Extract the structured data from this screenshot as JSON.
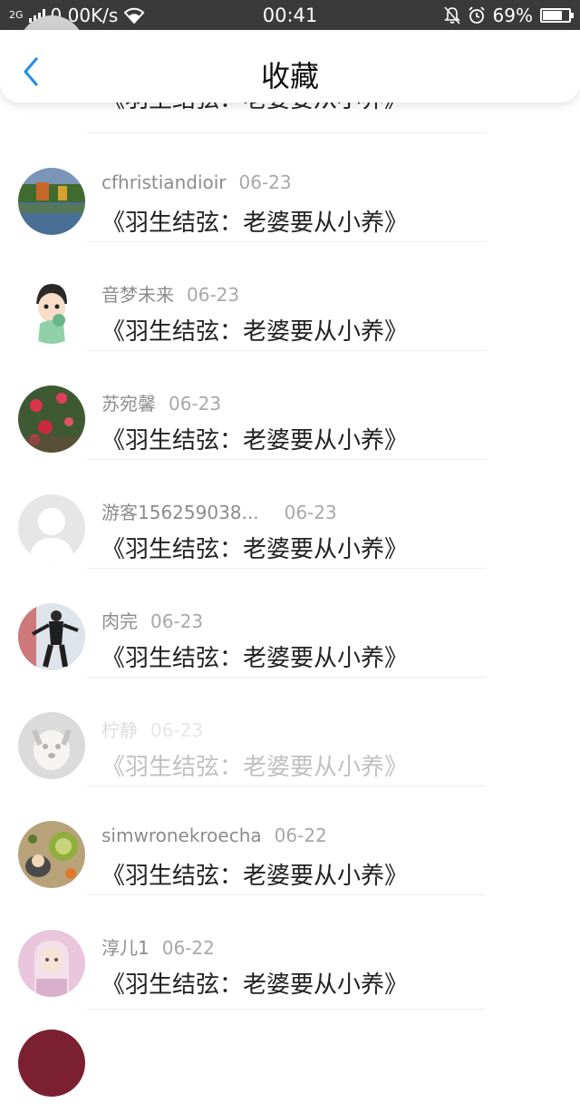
{
  "status_bar": {
    "network": "2G",
    "speed": "0.00K/s",
    "time": "00:41",
    "battery": "69%",
    "battery_level": 0.69
  },
  "header": {
    "title": "收藏"
  },
  "items": [
    {
      "user": "",
      "date": "",
      "title": "《羽生结弦：老婆要从小养》",
      "avatar": "partial-avatar"
    },
    {
      "user": "cfhristiandioir",
      "date": "06-23",
      "title": "《羽生结弦：老婆要从小养》",
      "avatar": "lake-landscape-avatar"
    },
    {
      "user": "音梦未来",
      "date": "06-23",
      "title": "《羽生结弦：老婆要从小养》",
      "avatar": "cartoon-boy-avatar"
    },
    {
      "user": "苏宛馨",
      "date": "06-23",
      "title": "《羽生结弦：老婆要从小养》",
      "avatar": "red-flowers-avatar"
    },
    {
      "user": "游客156259038...",
      "date": "06-23",
      "title": "《羽生结弦：老婆要从小养》",
      "avatar": "default-user-avatar"
    },
    {
      "user": "肉完",
      "date": "06-23",
      "title": "《羽生结弦：老婆要从小养》",
      "avatar": "skater-avatar"
    },
    {
      "user": "柠静",
      "date": "06-23",
      "title": "《羽生结弦：老婆要从小养》",
      "avatar": "dog-avatar"
    },
    {
      "user": "simwronekroecha",
      "date": "06-22",
      "title": "《羽生结弦：老婆要从小养》",
      "avatar": "food-avatar"
    },
    {
      "user": "淳儿1",
      "date": "06-22",
      "title": "《羽生结弦：老婆要从小养》",
      "avatar": "pink-girl-avatar"
    }
  ]
}
